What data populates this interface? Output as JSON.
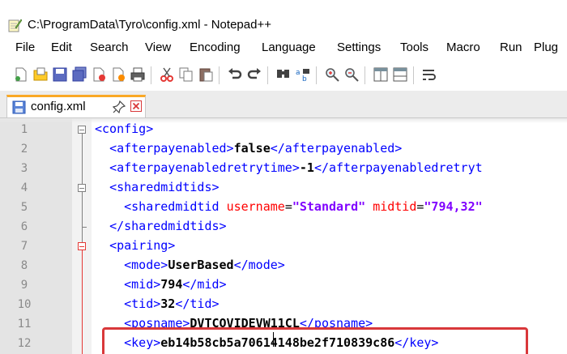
{
  "window": {
    "title": "C:\\ProgramData\\Tyro\\config.xml - Notepad++"
  },
  "menu": [
    "File",
    "Edit",
    "Search",
    "View",
    "Encoding",
    "Language",
    "Settings",
    "Tools",
    "Macro",
    "Run",
    "Plug"
  ],
  "toolbar": {
    "icons": [
      "new-file-icon",
      "open-file-icon",
      "save-icon",
      "save-all-icon",
      "close-icon",
      "close-all-icon",
      "print-icon",
      "cut-icon",
      "copy-icon",
      "paste-icon",
      "undo-icon",
      "redo-icon",
      "find-icon",
      "replace-icon",
      "zoom-in-icon",
      "zoom-out-icon",
      "sync-vertical-icon",
      "sync-horizontal-icon",
      "word-wrap-icon"
    ]
  },
  "tab": {
    "label": "config.xml",
    "pinned": true
  },
  "editor": {
    "line_numbers": [
      "1",
      "2",
      "3",
      "4",
      "5",
      "6",
      "7",
      "8",
      "9",
      "10",
      "11",
      "12"
    ],
    "lines": [
      {
        "indent": "",
        "parts": [
          {
            "t": "tag",
            "v": "<config>"
          }
        ]
      },
      {
        "indent": "  ",
        "parts": [
          {
            "t": "tag",
            "v": "<afterpayenabled>"
          },
          {
            "t": "val",
            "v": "false"
          },
          {
            "t": "tag",
            "v": "</afterpayenabled>"
          }
        ]
      },
      {
        "indent": "  ",
        "parts": [
          {
            "t": "tag",
            "v": "<afterpayenabledretrytime>"
          },
          {
            "t": "val",
            "v": "-1"
          },
          {
            "t": "tag",
            "v": "</afterpayenabledretryt"
          }
        ]
      },
      {
        "indent": "  ",
        "parts": [
          {
            "t": "tag",
            "v": "<sharedmidtids>"
          }
        ]
      },
      {
        "indent": "    ",
        "parts": [
          {
            "t": "tag",
            "v": "<sharedmidtid "
          },
          {
            "t": "attr",
            "v": "username"
          },
          {
            "t": "eq",
            "v": "="
          },
          {
            "t": "str",
            "v": "\"Standard\""
          },
          {
            "t": "eq",
            "v": " "
          },
          {
            "t": "attr",
            "v": "midtid"
          },
          {
            "t": "eq",
            "v": "="
          },
          {
            "t": "str",
            "v": "\"794,32\""
          }
        ]
      },
      {
        "indent": "  ",
        "parts": [
          {
            "t": "tag",
            "v": "</sharedmidtids>"
          }
        ]
      },
      {
        "indent": "  ",
        "parts": [
          {
            "t": "tag",
            "v": "<pairing>"
          }
        ]
      },
      {
        "indent": "    ",
        "parts": [
          {
            "t": "tag",
            "v": "<mode>"
          },
          {
            "t": "val",
            "v": "UserBased"
          },
          {
            "t": "tag",
            "v": "</mode>"
          }
        ]
      },
      {
        "indent": "    ",
        "parts": [
          {
            "t": "tag",
            "v": "<mid>"
          },
          {
            "t": "val",
            "v": "794"
          },
          {
            "t": "tag",
            "v": "</mid>"
          }
        ]
      },
      {
        "indent": "    ",
        "parts": [
          {
            "t": "tag",
            "v": "<tid>"
          },
          {
            "t": "val",
            "v": "32"
          },
          {
            "t": "tag",
            "v": "</tid>"
          }
        ]
      },
      {
        "indent": "    ",
        "parts": [
          {
            "t": "tag",
            "v": "<posname>"
          },
          {
            "t": "val",
            "v": "DVTCOVIDEVW11CL"
          },
          {
            "t": "tag",
            "v": "</posname>"
          }
        ]
      },
      {
        "indent": "    ",
        "parts": [
          {
            "t": "tag",
            "v": "<key>"
          },
          {
            "t": "val",
            "v": "eb14b58cb5a70614148be2f710839c86"
          },
          {
            "t": "tag",
            "v": "</key>"
          }
        ]
      }
    ]
  },
  "colors": {
    "tag": "#0000ff",
    "attribute": "#ff0000",
    "string": "#8000ff",
    "highlight_box": "#d9383a",
    "active_tab_accent": "#f9a825"
  }
}
